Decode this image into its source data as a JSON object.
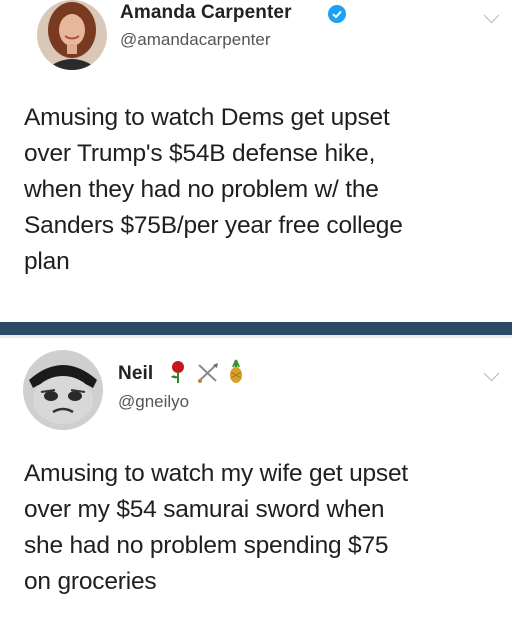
{
  "tweets": [
    {
      "author_name": "Amanda Carpenter",
      "handle": "@amandacarpenter",
      "verified": true,
      "lines": [
        "Amusing to watch Dems get upset",
        "over Trump's $54B defense hike,",
        "when they had no problem w/ the",
        "Sanders $75B/per year free college",
        "plan"
      ]
    },
    {
      "author_name": "Neil",
      "handle": "@gneilyo",
      "name_emojis": [
        "rose-icon",
        "crossed-swords-icon",
        "pineapple-icon"
      ],
      "lines": [
        "Amusing to watch my wife get upset",
        "over my $54 samurai sword when",
        "she had no problem spending $75",
        "on groceries"
      ]
    }
  ],
  "colors": {
    "divider": "#2c4a66",
    "verified": "#1da1f2",
    "text": "#1f1f1f",
    "handle": "#555555"
  }
}
